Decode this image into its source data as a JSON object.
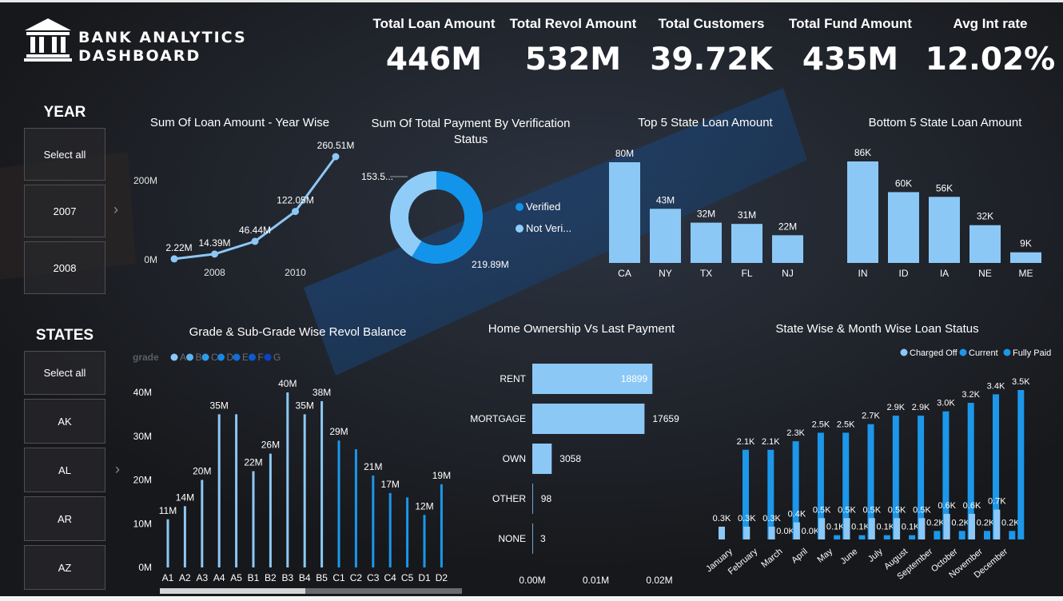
{
  "header": {
    "title_line1": "BANK ANALYTICS",
    "title_line2": "DASHBOARD",
    "logo_icon": "bank-building-icon"
  },
  "kpis": [
    {
      "label": "Total Loan Amount",
      "value": "446M"
    },
    {
      "label": "Total Revol Amount",
      "value": "532M"
    },
    {
      "label": "Total Customers",
      "value": "39.72K"
    },
    {
      "label": "Total Fund Amount",
      "value": "435M"
    },
    {
      "label": "Avg Int rate",
      "value": "12.02%"
    }
  ],
  "slicers": {
    "year": {
      "title": "YEAR",
      "items": [
        "Select all",
        "2007",
        "2008"
      ]
    },
    "states": {
      "title": "STATES",
      "items": [
        "Select all",
        "AK",
        "AL",
        "AR",
        "AZ"
      ]
    }
  },
  "colors": {
    "light_blue": "#8cc8f6",
    "mid_blue": "#1c97ea",
    "dark_blue": "#0a5fd6",
    "donut_light": "#8fcdf8",
    "donut_dark": "#1294ea"
  },
  "chart_data": [
    {
      "id": "year-line",
      "type": "line",
      "title": "Sum Of Loan Amount - Year Wise",
      "x": [
        2007,
        2008,
        2009,
        2010,
        2011
      ],
      "values": [
        2.22,
        14.39,
        46.44,
        122.05,
        260.51
      ],
      "labels": [
        "2.22M",
        "14.39M",
        "46.44M",
        "122.05M",
        "260.51M"
      ],
      "x_ticks": [
        "2008",
        "2010"
      ],
      "x_tick_values": [
        2008,
        2010
      ],
      "y_ticks": [
        "0M",
        "200M"
      ],
      "y_tick_values": [
        0,
        200
      ],
      "ylim": [
        0,
        260.51
      ]
    },
    {
      "id": "verification-donut",
      "type": "pie",
      "title": "Sum Of Total Payment By Verification Status",
      "slices": [
        {
          "name": "Verified",
          "value": 219.89,
          "label": "219.89M"
        },
        {
          "name": "Not Verified",
          "value": 153.5,
          "label": "153.5..."
        }
      ],
      "legend": [
        "Verified",
        "Not Veri..."
      ],
      "legend_placement": "right"
    },
    {
      "id": "top5-states",
      "type": "bar",
      "title": "Top 5 State Loan Amount",
      "categories": [
        "CA",
        "NY",
        "TX",
        "FL",
        "NJ"
      ],
      "values": [
        80,
        43,
        32,
        31,
        22
      ],
      "labels": [
        "80M",
        "43M",
        "32M",
        "31M",
        "22M"
      ],
      "ylim": [
        0,
        80
      ]
    },
    {
      "id": "bottom5-states",
      "type": "bar",
      "title": "Bottom 5 State Loan Amount",
      "categories": [
        "IN",
        "ID",
        "IA",
        "NE",
        "ME"
      ],
      "values": [
        86,
        60,
        56,
        32,
        9
      ],
      "labels": [
        "86K",
        "60K",
        "56K",
        "32K",
        "9K"
      ],
      "ylim": [
        0,
        86
      ]
    },
    {
      "id": "grade-revol",
      "type": "bar",
      "title": "Grade & Sub-Grade Wise Revol Balance",
      "legend_title": "grade",
      "legend": [
        "A",
        "B",
        "C",
        "D",
        "E",
        "F",
        "G"
      ],
      "legend_placement": "top-left",
      "categories": [
        "A1",
        "A2",
        "A3",
        "A4",
        "A5",
        "B1",
        "B2",
        "B3",
        "B4",
        "B5",
        "C1",
        "C2",
        "C3",
        "C4",
        "C5",
        "D1",
        "D2"
      ],
      "values": [
        11,
        14,
        20,
        35,
        35,
        22,
        26,
        40,
        35,
        38,
        29,
        27,
        21,
        17,
        16,
        12,
        19
      ],
      "labels": [
        "11M",
        "14M",
        "20M",
        "35M",
        "",
        "22M",
        "26M",
        "40M",
        "35M",
        "38M",
        "29M",
        "",
        "21M",
        "17M",
        "",
        "12M",
        "19M"
      ],
      "groups": [
        "A",
        "A",
        "A",
        "A",
        "A",
        "B",
        "B",
        "B",
        "B",
        "B",
        "C",
        "C",
        "C",
        "C",
        "C",
        "D",
        "D"
      ],
      "y_ticks": [
        "0M",
        "10M",
        "20M",
        "30M",
        "40M"
      ],
      "y_tick_values": [
        0,
        10,
        20,
        30,
        40
      ],
      "ylim": [
        0,
        40
      ]
    },
    {
      "id": "home-ownership",
      "type": "bar",
      "orientation": "horizontal",
      "title": "Home Ownership Vs Last Payment",
      "categories": [
        "RENT",
        "MORTGAGE",
        "OWN",
        "OTHER",
        "NONE"
      ],
      "values": [
        18899,
        17659,
        3058,
        98,
        3
      ],
      "labels": [
        "18899",
        "17659",
        "3058",
        "98",
        "3"
      ],
      "x_ticks": [
        "0.00M",
        "0.01M",
        "0.02M"
      ],
      "x_tick_values": [
        0,
        10000,
        20000
      ],
      "xlim": [
        0,
        20000
      ]
    },
    {
      "id": "month-status",
      "type": "bar",
      "title": "State Wise & Month Wise Loan Status",
      "categories": [
        "January",
        "February",
        "March",
        "April",
        "May",
        "June",
        "July",
        "August",
        "September",
        "October",
        "November",
        "December"
      ],
      "series": [
        {
          "name": "Charged Off",
          "values": [
            0.3,
            0.3,
            0.3,
            0.4,
            0.5,
            0.5,
            0.5,
            0.5,
            0.5,
            0.6,
            0.6,
            0.7
          ],
          "labels": [
            "0.3K",
            "0.3K",
            "0.3K",
            "0.4K",
            "0.5K",
            "0.5K",
            "0.5K",
            "0.5K",
            "0.5K",
            "0.6K",
            "0.6K",
            "0.7K"
          ]
        },
        {
          "name": "Current",
          "values": [
            0,
            0,
            0.0,
            0.0,
            0.1,
            0.1,
            0.1,
            0.1,
            0.2,
            0.2,
            0.2,
            0.2
          ],
          "labels": [
            "",
            "",
            "0.0K",
            "0.0K",
            "0.1K",
            "0.1K",
            "0.1K",
            "0.1K",
            "0.2K",
            "0.2K",
            "0.2K",
            "0.2K"
          ]
        },
        {
          "name": "Fully Paid",
          "values": [
            2.1,
            2.1,
            2.3,
            2.5,
            2.5,
            2.7,
            2.9,
            2.9,
            3.0,
            3.2,
            3.4,
            3.5
          ],
          "labels": [
            "2.1K",
            "2.1K",
            "2.3K",
            "2.5K",
            "2.5K",
            "2.7K",
            "2.9K",
            "2.9K",
            "3.0K",
            "3.2K",
            "3.4K",
            "3.5K"
          ]
        }
      ],
      "legend_placement": "top-right",
      "ylim": [
        0,
        3.5
      ]
    }
  ]
}
